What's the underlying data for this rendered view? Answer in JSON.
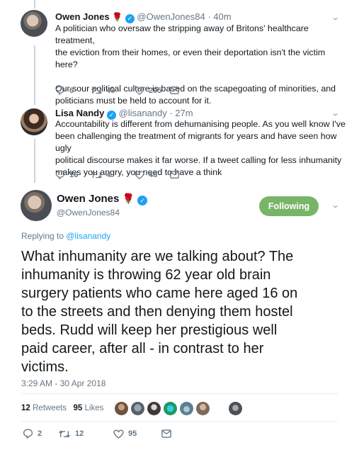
{
  "tweet1": {
    "name": "Owen Jones",
    "rose": "🌹",
    "handle_time": "@OwenJones84 · 40m",
    "lines": [
      "A politician who oversaw the stripping away of Britons' healthcare treatment,",
      "the eviction from their homes, or even their deportation isn't the victim here?",
      "Our sour political culture is based on the scapegoating of minorities, and",
      "politicians must be held to account for it."
    ],
    "replies": "6",
    "retweets": "43",
    "likes": "205"
  },
  "tweet2": {
    "name": "Lisa Nandy",
    "handle_time": "@lisanandy · 27m",
    "lines": [
      "Accountability is different from dehumanising people. As you well know I've",
      "been challenging the treatment of migrants for years and have seen how ugly",
      "political discourse makes it far worse. If a tweet calling for less inhumanity",
      "makes you angry, you need to have a think"
    ],
    "replies": "16",
    "retweets": "4",
    "likes": "48"
  },
  "main": {
    "name": "Owen Jones",
    "rose": "🌹",
    "handle": "@OwenJones84",
    "follow_label": "Following",
    "replying_prefix": "Replying to ",
    "replying_handle": "@lisanandy",
    "lines": [
      "What inhumanity are we talking about? The",
      "inhumanity is throwing 62 year old brain",
      "surgery patients who came here aged 16 on",
      "to the streets and then denying them hostel",
      "beds. Rudd will keep her prestigious well",
      "paid career, after all - in contrast to her",
      "victims."
    ],
    "timestamp": "3:29 AM - 30 Apr 2018",
    "retweets_count": "12",
    "retweets_label": "Retweets",
    "likes_count": "95",
    "likes_label": "Likes",
    "replies": "2",
    "retweets": "12",
    "likes": "95"
  },
  "colors": {
    "link": "#1da1f2",
    "follow_bg": "#79b567",
    "verified": "#1da1f2",
    "rose": "#c4142d",
    "muted": "#657786"
  }
}
